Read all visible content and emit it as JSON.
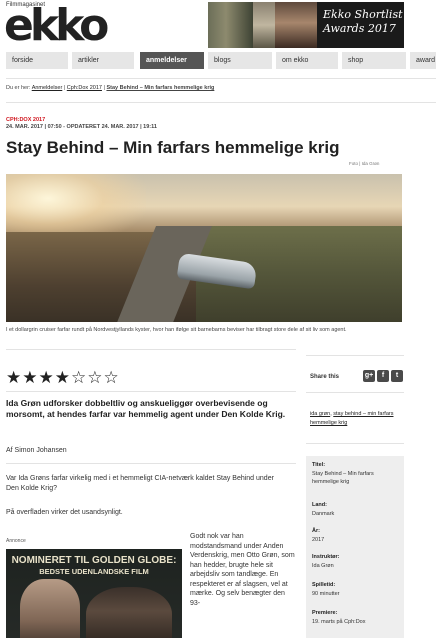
{
  "header": {
    "logo_sub": "Filmmagasinet",
    "logo_text": "ekko",
    "banner_text": "Ekko Shortlist Awards 2017"
  },
  "nav": {
    "items": [
      {
        "label": "forside"
      },
      {
        "label": "artikler"
      },
      {
        "label": "anmeldelser",
        "active": true
      },
      {
        "label": "blogs"
      },
      {
        "label": "om ekko"
      },
      {
        "label": "shop"
      },
      {
        "label": "award"
      }
    ]
  },
  "breadcrumb": {
    "prefix": "Du er her:",
    "items": [
      "Anmeldelser",
      "Cph:Dox 2017",
      "Stay Behind – Min farfars hemmelige krig"
    ],
    "separator": "|"
  },
  "article": {
    "kicker": "CPH:DOX 2017",
    "dateline": "24. MAR. 2017 | 07:50 - OPDATERET 24. MAR. 2017 | 19:11",
    "title": "Stay Behind – Min farfars hemmelige krig",
    "photo_credit": "Foto | Ida Grøn",
    "caption": "I et dollargrin cruiser farfar rundt på Nordvestjyllands kyster, hvor han ifølge sit barnebarns beviser har tilbragt store dele af sit liv som agent.",
    "rating": 4,
    "rating_max": 7,
    "stars": "★★★★☆☆☆",
    "lead": "Ida Grøn udforsker dobbeltliv og anskueliggør overbevisende og morsomt, at hendes farfar var hemmelig agent under Den Kolde Krig.",
    "author": "Af Simon Johansen",
    "para1": "Var Ida Grøns farfar virkelig med i et hemmeligt CIA-netværk kaldet Stay Behind under Den Kolde Krig?",
    "para2": "På overfladen virker det usandsynligt.",
    "column_text": "Godt nok var han modstandsmand under Anden Verdenskrig, men Otto Grøn, som han hedder, brugte hele sit arbejdsliv som tandlæge. En respekteret er af slagsen, vel at mærke. Og selv benægter den 93-"
  },
  "ad": {
    "label": "Annonce",
    "headline": "NOMINERET TIL GOLDEN GLOBE:",
    "subline": "BEDSTE UDENLANDSKE FILM"
  },
  "sidebar": {
    "share_label": "Share this",
    "share_icons": [
      {
        "name": "google-plus-icon",
        "glyph": "g+"
      },
      {
        "name": "facebook-icon",
        "glyph": "f"
      },
      {
        "name": "twitter-icon",
        "glyph": "t"
      }
    ],
    "tags": [
      "ida grøn",
      "stay behind – min farfars hemmelige krig"
    ],
    "facts": [
      {
        "label": "Titel:",
        "value": "Stay Behind – Min farfars hemmelige krig"
      },
      {
        "label": "Land:",
        "value": "Danmark"
      },
      {
        "label": "År:",
        "value": "2017"
      },
      {
        "label": "Instruktør:",
        "value": "Ida Grøn"
      },
      {
        "label": "Spilletid:",
        "value": "90 minutter"
      },
      {
        "label": "Premiere:",
        "value": "19. marts på Cph:Dox"
      }
    ]
  },
  "colors": {
    "kicker": "#d0161e",
    "nav_active": "#555555",
    "nav_bg": "#e6e6e6"
  }
}
